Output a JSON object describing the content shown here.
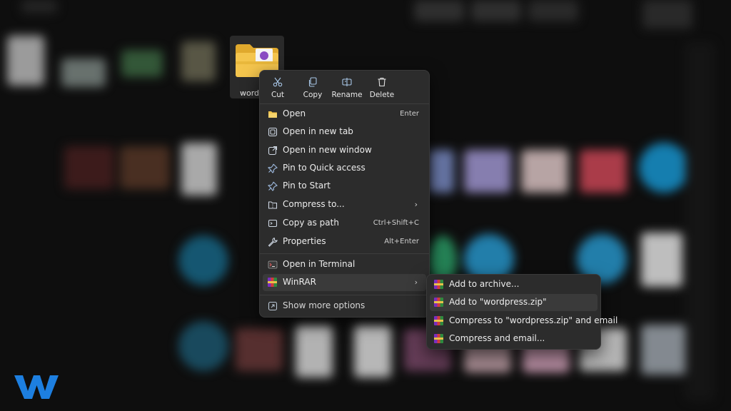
{
  "folder": {
    "name_partial": "wordp"
  },
  "quick_actions": [
    {
      "label": "Cut",
      "icon": "scissors-icon"
    },
    {
      "label": "Copy",
      "icon": "copy-icon"
    },
    {
      "label": "Rename",
      "icon": "rename-icon"
    },
    {
      "label": "Delete",
      "icon": "trash-icon"
    }
  ],
  "menu": {
    "items": [
      {
        "label": "Open",
        "shortcut": "Enter",
        "icon": "folder-open-icon"
      },
      {
        "label": "Open in new tab",
        "icon": "new-tab-icon"
      },
      {
        "label": "Open in new window",
        "icon": "new-window-icon"
      },
      {
        "label": "Pin to Quick access",
        "icon": "pin-icon"
      },
      {
        "label": "Pin to Start",
        "icon": "pin-icon"
      },
      {
        "label": "Compress to...",
        "icon": "zip-folder-icon",
        "submenu": true
      },
      {
        "label": "Copy as path",
        "shortcut": "Ctrl+Shift+C",
        "icon": "path-icon"
      },
      {
        "label": "Properties",
        "shortcut": "Alt+Enter",
        "icon": "wrench-icon"
      },
      {
        "label": "Open in Terminal",
        "icon": "terminal-icon"
      },
      {
        "label": "WinRAR",
        "icon": "winrar-icon",
        "submenu": true
      },
      {
        "label": "Show more options",
        "icon": "more-options-icon"
      }
    ]
  },
  "winrar_submenu": {
    "items": [
      {
        "label": "Add to archive..."
      },
      {
        "label": "Add to \"wordpress.zip\""
      },
      {
        "label": "Compress to \"wordpress.zip\" and email"
      },
      {
        "label": "Compress and email..."
      }
    ]
  },
  "colors": {
    "menu_bg": "#2c2c2c",
    "highlight": "#3a3a3a",
    "brand_blue": "#1d7fe0",
    "folder_yellow": "#f2c44c"
  }
}
